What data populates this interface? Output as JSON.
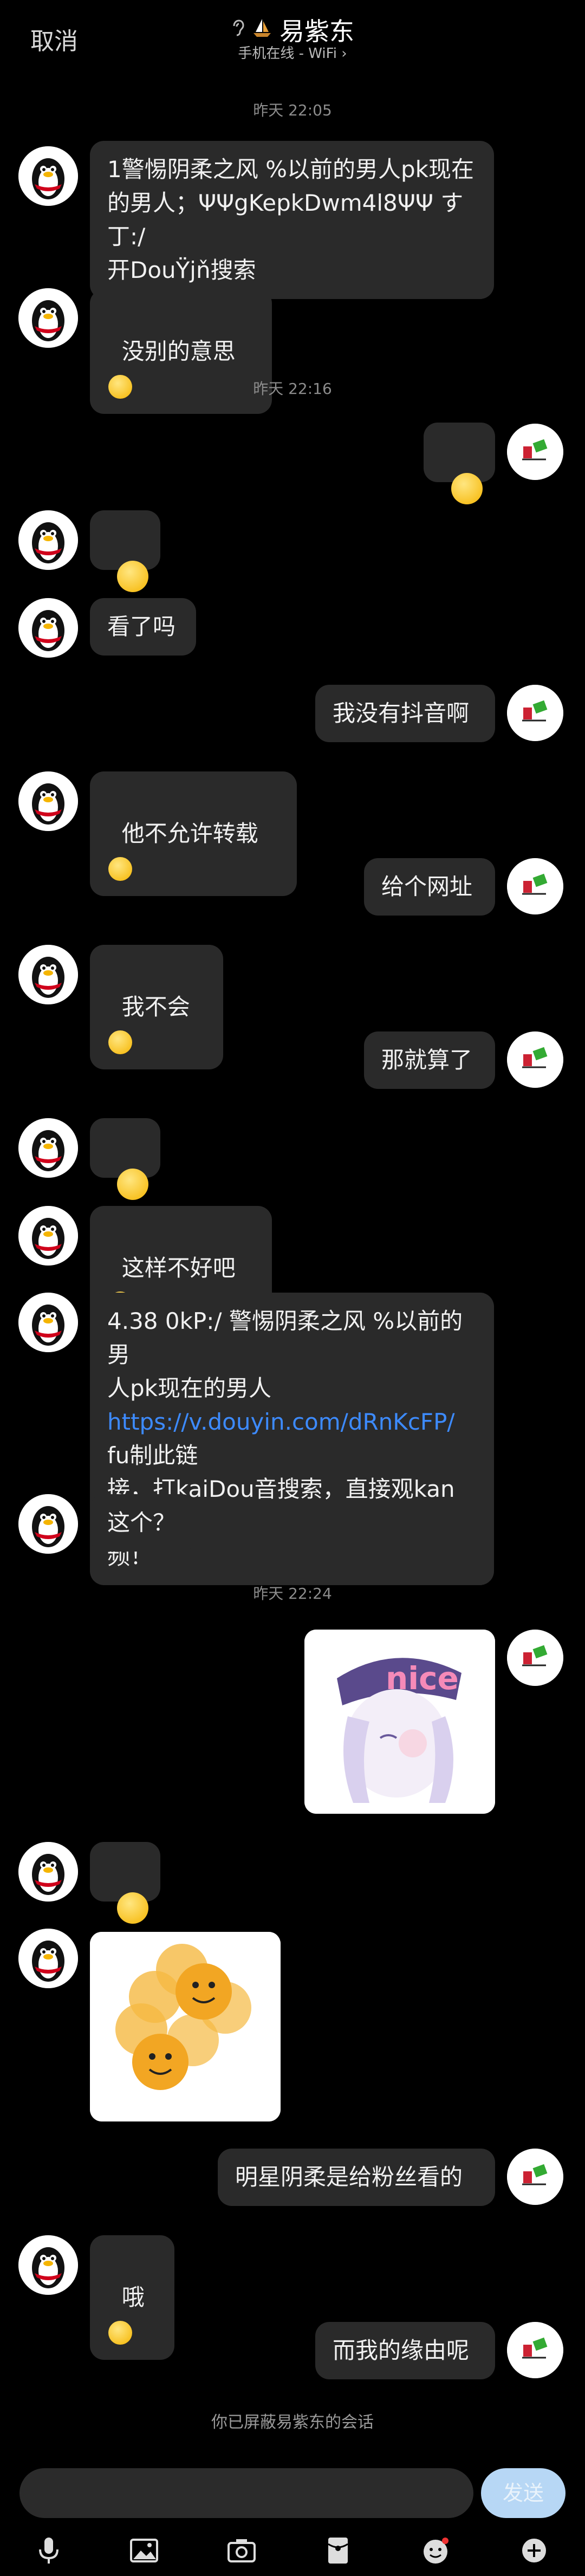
{
  "header": {
    "cancel_label": "取消",
    "title": "易紫东",
    "subtitle": "手机在线 - WiFi"
  },
  "timestamps": [
    "昨天 22:05",
    "昨天 22:16",
    "昨天 22:24"
  ],
  "messages": [
    {
      "text": "1警惕阴柔之风 %以前的男人pk现在\n的男人；ΨΨgKepkDwm4l8ΨΨ す丁:/\n开DouΫjň搜索"
    },
    {
      "text": "没别的意思"
    },
    {
      "text": ""
    },
    {
      "text": ""
    },
    {
      "text": "看了吗"
    },
    {
      "text": "我没有抖音啊"
    },
    {
      "text": "他不允许转载"
    },
    {
      "text": "给个网址"
    },
    {
      "text": "我不会"
    },
    {
      "text": "那就算了"
    },
    {
      "text": ""
    },
    {
      "text": "这样不好吧"
    },
    {
      "text": "4.38 0kP:/ 警惕阴柔之风 %以前的男\n人pk现在的男人",
      "link": "https://v.douyin.com/dRnKcFP/",
      "after": " fu制此链\n接，打kaiDou音搜索，直接观kan视\n频！"
    },
    {
      "text": "这个？"
    },
    {
      "text": "nice"
    },
    {
      "text": ""
    },
    {
      "text": ""
    },
    {
      "text": "明星阴柔是给粉丝看的"
    },
    {
      "text": "哦"
    },
    {
      "text": "而我的缘由呢"
    }
  ],
  "footer": {
    "blocked_notice": "你已屏蔽易紫东的会话",
    "send_label": "发送"
  },
  "toolbar": {
    "icons": [
      "mic-icon",
      "image-icon",
      "camera-icon",
      "red-packet-icon",
      "emoji-icon",
      "plus-icon"
    ]
  },
  "colors": {
    "background": "#000000",
    "bubble": "#2a2a2a",
    "link": "#3d8bff",
    "send_button": "#b7d7f5"
  }
}
